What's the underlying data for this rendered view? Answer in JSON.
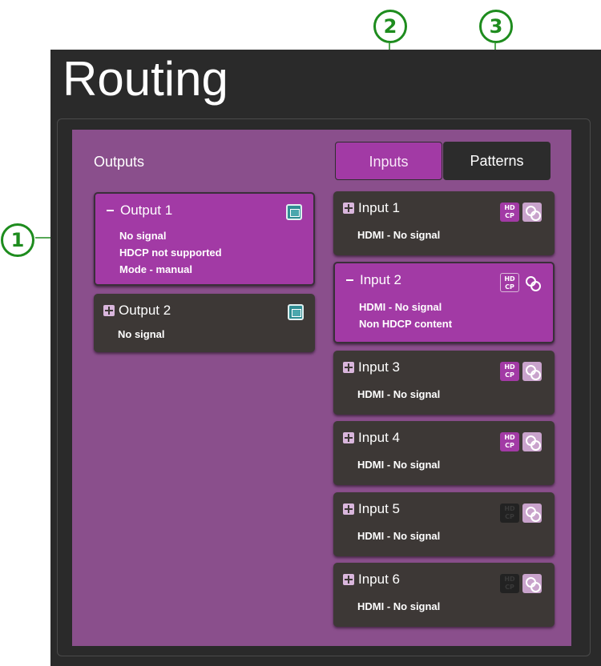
{
  "header": {
    "title": "Routing"
  },
  "callouts": [
    "1",
    "2",
    "3"
  ],
  "outputs": {
    "label": "Outputs",
    "items": [
      {
        "name": "Output 1",
        "expanded": true,
        "lines": [
          "No signal",
          "HDCP not supported",
          "Mode - manual"
        ]
      },
      {
        "name": "Output 2",
        "expanded": false,
        "lines": [
          "No signal"
        ]
      }
    ]
  },
  "tabs": {
    "inputs": "Inputs",
    "patterns": "Patterns"
  },
  "inputs": [
    {
      "name": "Input 1",
      "expanded": false,
      "hdcp_enabled": true,
      "lines": [
        "HDMI - No signal"
      ]
    },
    {
      "name": "Input 2",
      "expanded": true,
      "hdcp_enabled": true,
      "lines": [
        "HDMI - No signal",
        "Non HDCP content"
      ]
    },
    {
      "name": "Input 3",
      "expanded": false,
      "hdcp_enabled": true,
      "lines": [
        "HDMI - No signal"
      ]
    },
    {
      "name": "Input 4",
      "expanded": false,
      "hdcp_enabled": true,
      "lines": [
        "HDMI - No signal"
      ]
    },
    {
      "name": "Input 5",
      "expanded": false,
      "hdcp_enabled": false,
      "lines": [
        "HDMI - No signal"
      ]
    },
    {
      "name": "Input 6",
      "expanded": false,
      "hdcp_enabled": false,
      "lines": [
        "HDMI - No signal"
      ]
    }
  ],
  "hdcp_badge": {
    "line1": "HD",
    "line2": "CP"
  },
  "icons": {
    "expand": "plus-icon",
    "collapse": "minus-icon",
    "output": "display-icon",
    "link": "link-icon"
  },
  "colors": {
    "accent": "#a23aa5",
    "panel": "#8a4f8c",
    "frame": "#2a2a2a",
    "card": "#3d3836",
    "callout": "#1e8c1e"
  }
}
